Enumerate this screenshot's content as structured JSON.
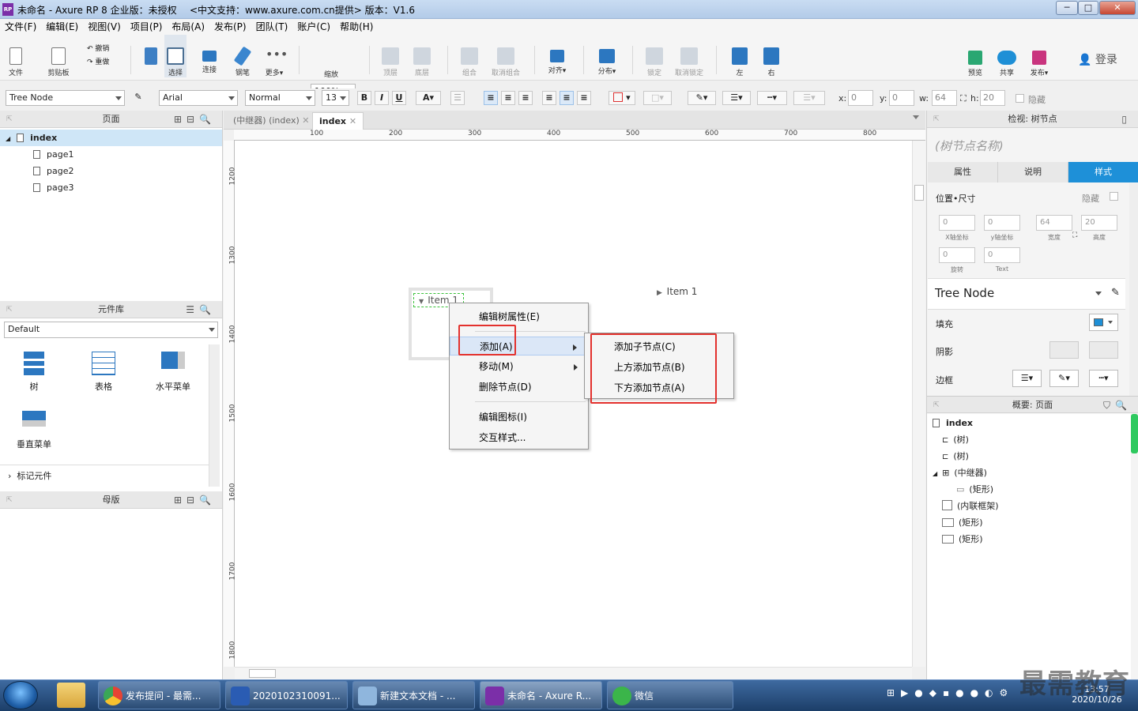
{
  "window": {
    "title": "未命名 - Axure RP 8 企业版：未授权",
    "subtitle": "<中文支持：www.axure.com.cn提供> 版本：V1.6",
    "minimize": "─",
    "maximize": "□",
    "close": "✕"
  },
  "menu": [
    "文件(F)",
    "编辑(E)",
    "视图(V)",
    "项目(P)",
    "布局(A)",
    "发布(P)",
    "团队(T)",
    "账户(C)",
    "帮助(H)"
  ],
  "toolbar": {
    "file": "文件",
    "clipboard": "剪贴板",
    "undo": "撤销",
    "redo": "重做",
    "select": "选择",
    "connect": "连接",
    "pen": "钢笔",
    "more": "更多▾",
    "zoom_value": "100%",
    "zoom": "缩放",
    "top": "顶层",
    "bottom": "底层",
    "group": "组合",
    "ungroup": "取消组合",
    "align": "对齐▾",
    "distribute": "分布▾",
    "lock": "锁定",
    "unlock": "取消锁定",
    "left": "左",
    "right": "右",
    "preview": "预览",
    "share": "共享",
    "publish": "发布▾",
    "login": "登录"
  },
  "format": {
    "widget_type": "Tree Node",
    "font": "Arial",
    "style": "Normal",
    "size": "13",
    "bold": "B",
    "italic": "I",
    "underline": "U",
    "x_label": "x:",
    "x": "0",
    "y_label": "y:",
    "y": "0",
    "w_label": "w:",
    "w": "64",
    "h_label": "h:",
    "h": "20",
    "hidden": "隐藏"
  },
  "pages_panel": {
    "title": "页面",
    "items": [
      "index",
      "page1",
      "page2",
      "page3"
    ]
  },
  "library_panel": {
    "title": "元件库",
    "library": "Default",
    "widgets": [
      "树",
      "表格",
      "水平菜单",
      "垂直菜单"
    ],
    "marker": "标记元件"
  },
  "master_panel": {
    "title": "母版"
  },
  "tabs": [
    "(中继器) (index)",
    "index"
  ],
  "ruler_h": [
    "100",
    "200",
    "300",
    "400",
    "500",
    "600",
    "700",
    "800"
  ],
  "ruler_v": [
    "1200",
    "1300",
    "1400",
    "1500",
    "1600",
    "1700",
    "1800"
  ],
  "canvas": {
    "tree_node_1": "Item 1",
    "tree_node_2": "Item 1"
  },
  "context_menu": {
    "items": [
      "编辑树属性(E)",
      "添加(A)",
      "移动(M)",
      "删除节点(D)",
      "编辑图标(I)",
      "交互样式..."
    ],
    "submenu": [
      "添加子节点(C)",
      "上方添加节点(B)",
      "下方添加节点(A)"
    ]
  },
  "inspector": {
    "title": "检视: 树节点",
    "name_placeholder": "(树节点名称)",
    "tabs": [
      "属性",
      "说明",
      "样式"
    ],
    "pos_size": "位置•尺寸",
    "hidden": "隐藏",
    "fields": [
      {
        "value": "0",
        "label": "X轴坐标"
      },
      {
        "value": "0",
        "label": "y轴坐标"
      },
      {
        "value": "64",
        "label": "宽度"
      },
      {
        "value": "20",
        "label": "高度"
      },
      {
        "value": "0",
        "label": "旋转"
      },
      {
        "value": "0",
        "label": "Text"
      }
    ],
    "style_name": "Tree Node",
    "fill": "填充",
    "shadow": "阴影",
    "border": "边框",
    "fill_color": "#1e8fd6"
  },
  "outline": {
    "title": "概要: 页面",
    "items": [
      "index",
      "(树)",
      "(树)",
      "(中继器)",
      "(矩形)",
      "(内联框架)",
      "(矩形)",
      "(矩形)"
    ]
  },
  "taskbar": {
    "items": [
      "发布提问 - 最需...",
      "2020102310091...",
      "新建文本文档 - ...",
      "未命名 - Axure R...",
      "微信"
    ],
    "time": "13:57",
    "date": "2020/10/26"
  },
  "watermark": "最需教育"
}
